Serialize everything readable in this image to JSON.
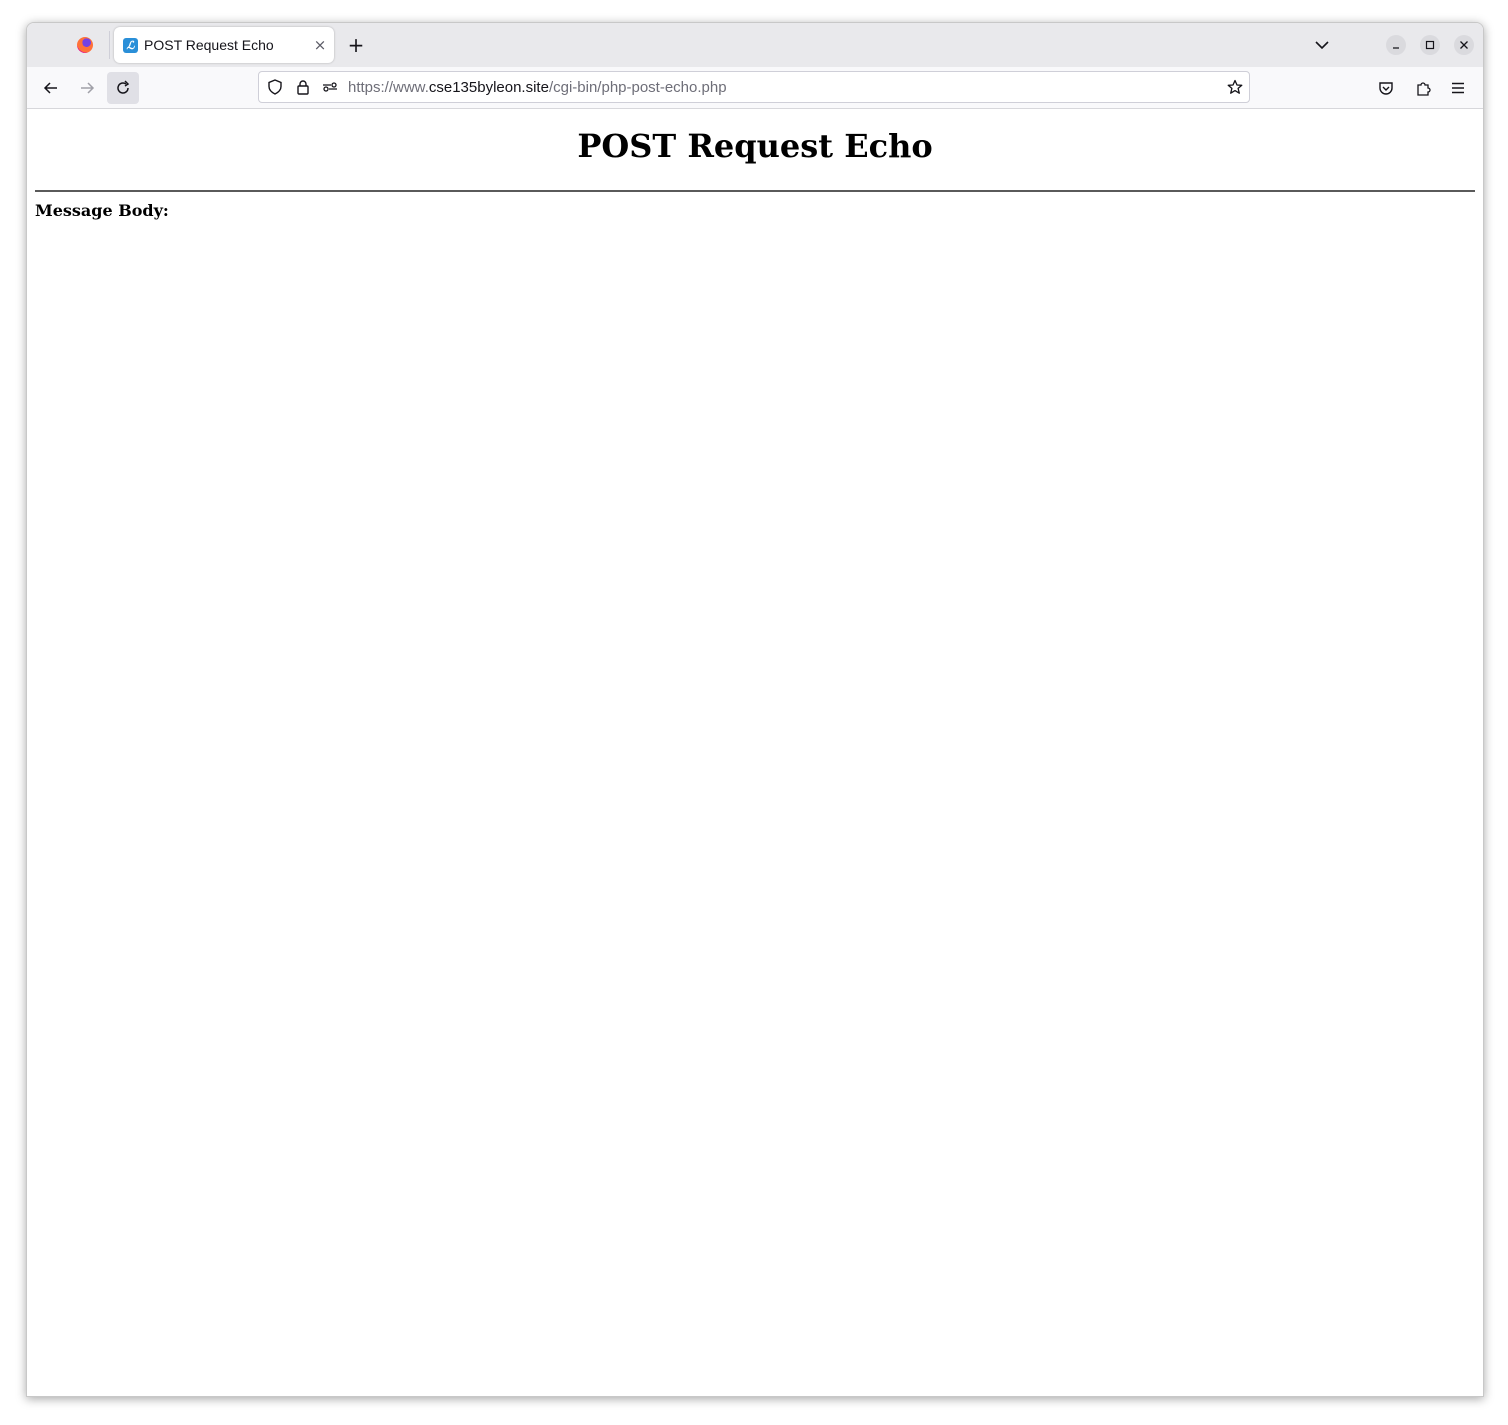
{
  "browser": {
    "tab": {
      "title": "POST Request Echo",
      "favicon": "lets-encrypt-favicon",
      "close_label": "×"
    },
    "new_tab_label": "+",
    "url": {
      "scheme_prefix": "https://www.",
      "host": "cse135byleon.site",
      "path": "/cgi-bin/php-post-echo.php"
    },
    "icons": [
      "firefox-icon",
      "back-icon",
      "forward-icon",
      "reload-icon",
      "shield-icon",
      "lock-icon",
      "permissions-icon",
      "bookmark-star-icon",
      "pocket-icon",
      "extensions-icon",
      "menu-icon",
      "list-tabs-icon",
      "minimize-icon",
      "maximize-icon",
      "close-window-icon"
    ]
  },
  "page": {
    "heading": "POST Request Echo",
    "message_body_label": "Message Body:"
  },
  "colors": {
    "tab_strip": "#e9e9ec",
    "toolbar": "#f9f9fb",
    "accent_favicon": "#2a8fd8"
  }
}
